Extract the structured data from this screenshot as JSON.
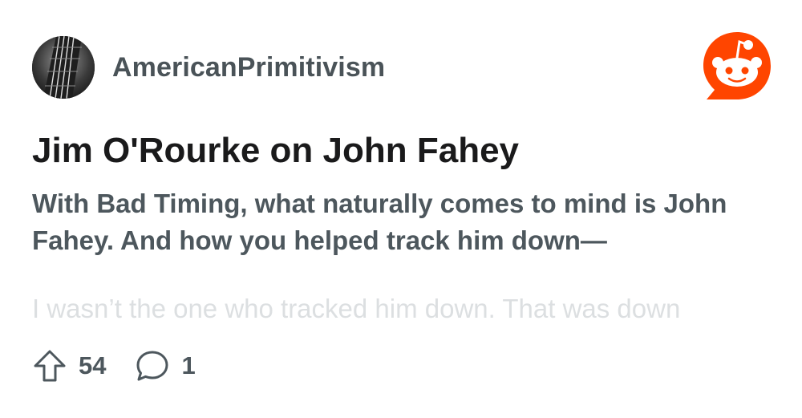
{
  "post": {
    "subreddit": "AmericanPrimitivism",
    "title": "Jim O'Rourke on John Fahey",
    "subtitle": "With Bad Timing, what naturally comes to mind is John Fahey. And how you helped track him down—",
    "body_preview": "I wasn’t the one who tracked him down. That was down",
    "upvotes": "54",
    "comments": "1"
  },
  "icons": {
    "avatar": "guitar-neck-avatar",
    "brand": "reddit-logo-icon",
    "upvote": "upvote-arrow-icon",
    "comment": "comment-bubble-icon"
  },
  "colors": {
    "brand_orange": "#ff4500",
    "text_dark": "#1a1a1b",
    "text_muted": "#4d575d",
    "text_faded": "#dcdfe1"
  }
}
